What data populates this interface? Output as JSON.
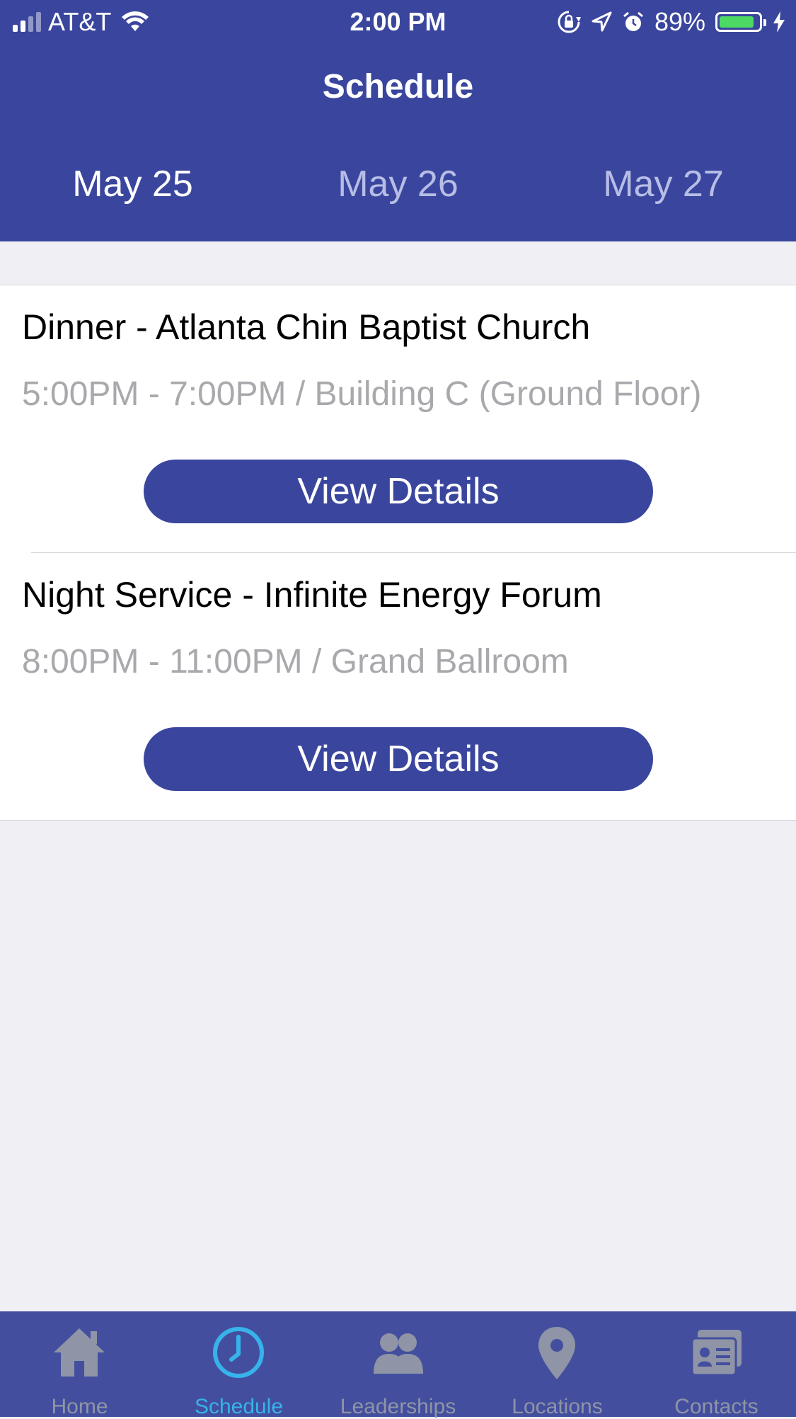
{
  "status_bar": {
    "carrier": "AT&T",
    "time": "2:00 PM",
    "battery": "89%",
    "battery_level": 0.89,
    "icons": [
      "signal-icon",
      "wifi-icon",
      "orientation-lock-icon",
      "location-arrow-icon",
      "alarm-icon",
      "battery-icon",
      "charging-bolt-icon"
    ]
  },
  "header": {
    "title": "Schedule",
    "dates": [
      "May 25",
      "May 26",
      "May 27"
    ],
    "selected_date": "May 25"
  },
  "events": [
    {
      "title": "Dinner - Atlanta Chin Baptist Church",
      "subtitle": "5:00PM - 7:00PM / Building C (Ground Floor)",
      "button": "View Details"
    },
    {
      "title": "Night Service - Infinite Energy Forum",
      "subtitle": "8:00PM - 11:00PM / Grand Ballroom",
      "button": "View Details"
    }
  ],
  "tabbar": {
    "items": [
      {
        "label": "Home",
        "icon": "home-icon"
      },
      {
        "label": "Schedule",
        "icon": "clock-icon"
      },
      {
        "label": "Leaderships",
        "icon": "people-icon"
      },
      {
        "label": "Locations",
        "icon": "map-pin-icon"
      },
      {
        "label": "Contacts",
        "icon": "contact-card-icon"
      }
    ],
    "active": "Schedule"
  },
  "colors": {
    "primary": "#3a469d",
    "tabbar": "#434f9e",
    "active_tab": "#37b3ea",
    "inactive_tab": "#8f94a6",
    "background": "#efeff4",
    "battery": "#4cd964"
  }
}
